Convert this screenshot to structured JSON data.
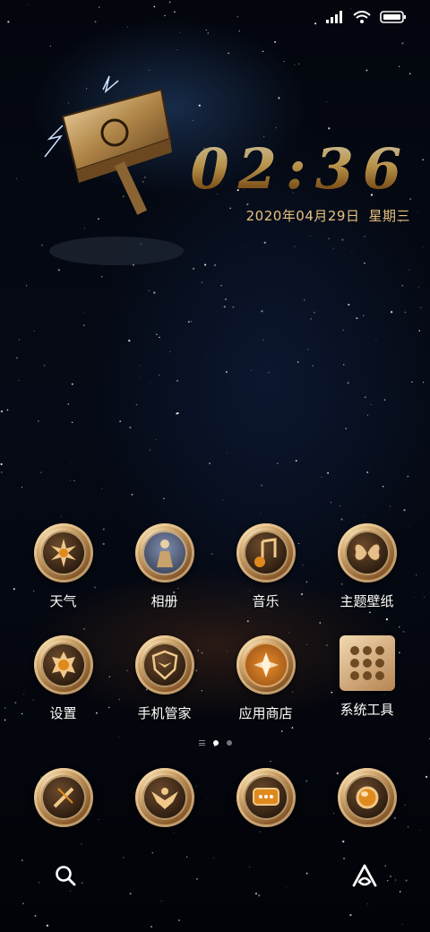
{
  "status_bar": {
    "signal": "signal-icon",
    "wifi": "wifi-icon",
    "battery": "battery-icon"
  },
  "clock": {
    "time": "02:36",
    "date": "2020年04月29日",
    "weekday": "星期三"
  },
  "home_rows": [
    [
      {
        "label": "天气",
        "icon": "weather-sun-icon"
      },
      {
        "label": "相册",
        "icon": "gallery-icon"
      },
      {
        "label": "音乐",
        "icon": "music-note-icon"
      },
      {
        "label": "主题壁纸",
        "icon": "butterfly-theme-icon"
      }
    ],
    [
      {
        "label": "设置",
        "icon": "settings-gear-icon"
      },
      {
        "label": "手机管家",
        "icon": "shield-eagle-icon"
      },
      {
        "label": "应用商店",
        "icon": "app-store-icon"
      },
      {
        "label": "系统工具",
        "icon": "system-tools-folder-icon"
      }
    ]
  ],
  "dock": [
    {
      "icon": "phone-icon"
    },
    {
      "icon": "contacts-eagle-icon"
    },
    {
      "icon": "messages-icon"
    },
    {
      "icon": "browser-orb-icon"
    }
  ],
  "page_indicator": {
    "pages": 2,
    "active": 1
  },
  "bottom": {
    "left": "search-icon",
    "right": "assistant-icon"
  },
  "colors": {
    "accent_gold": "#e9c27d",
    "label": "#ffffff"
  }
}
